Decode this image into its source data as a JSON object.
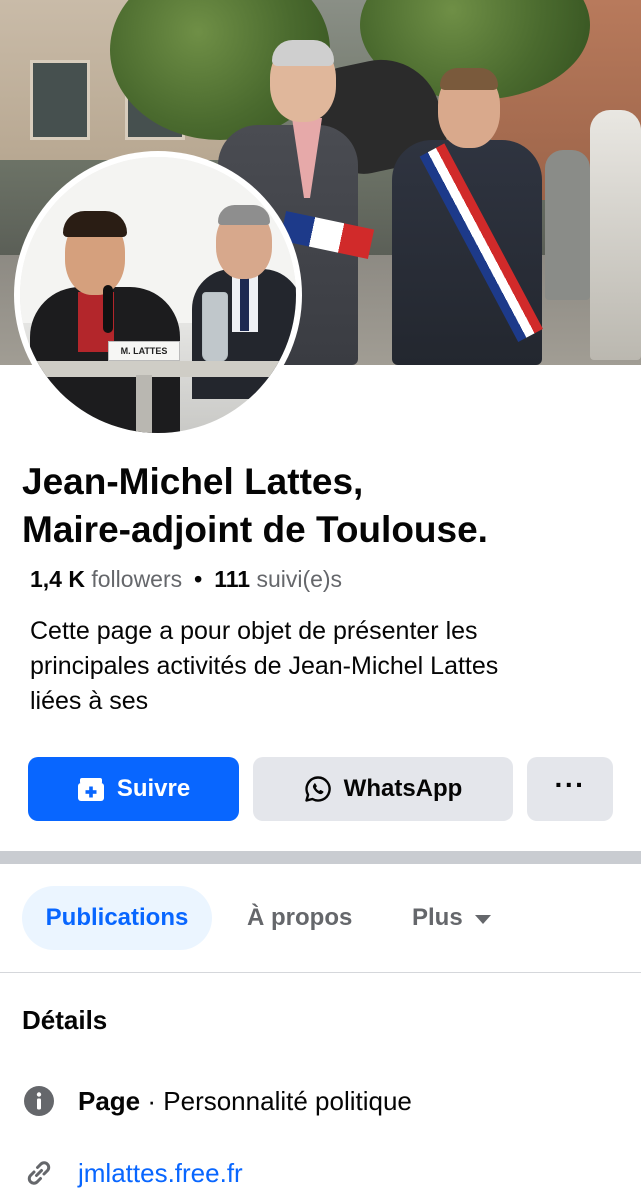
{
  "profile": {
    "name_line1": "Jean-Michel Lattes,",
    "name_line2": "Maire-adjoint de Toulouse.",
    "followers_count": "1,4 K",
    "followers_label": "followers",
    "separator": "•",
    "following_count": "111",
    "following_label": "suivi(e)s",
    "description_line1": "Cette page a pour objet de présenter les",
    "description_line2": "principales activités de Jean-Michel Lattes",
    "description_line3": "liées à ses",
    "avatar_nameplate": "M. LATTES"
  },
  "actions": {
    "follow_label": "Suivre",
    "whatsapp_label": "WhatsApp",
    "more_label": "···"
  },
  "tabs": [
    {
      "label": "Publications",
      "active": true
    },
    {
      "label": "À propos",
      "active": false
    },
    {
      "label": "Plus",
      "active": false
    }
  ],
  "details": {
    "heading": "Détails",
    "category_prefix": "Page",
    "category_sep": " · ",
    "category_value": "Personnalité politique",
    "website": "jmlattes.free.fr"
  },
  "colors": {
    "accent": "#0866ff",
    "button_gray": "#e4e6eb",
    "secondary_text": "#65676b",
    "active_tab_bg": "#ebf5ff"
  },
  "icons": {
    "follow": "follow-page-icon",
    "whatsapp": "whatsapp-icon",
    "more": "more-options-icon",
    "info": "info-icon",
    "link": "link-icon",
    "caret": "caret-down-icon"
  }
}
